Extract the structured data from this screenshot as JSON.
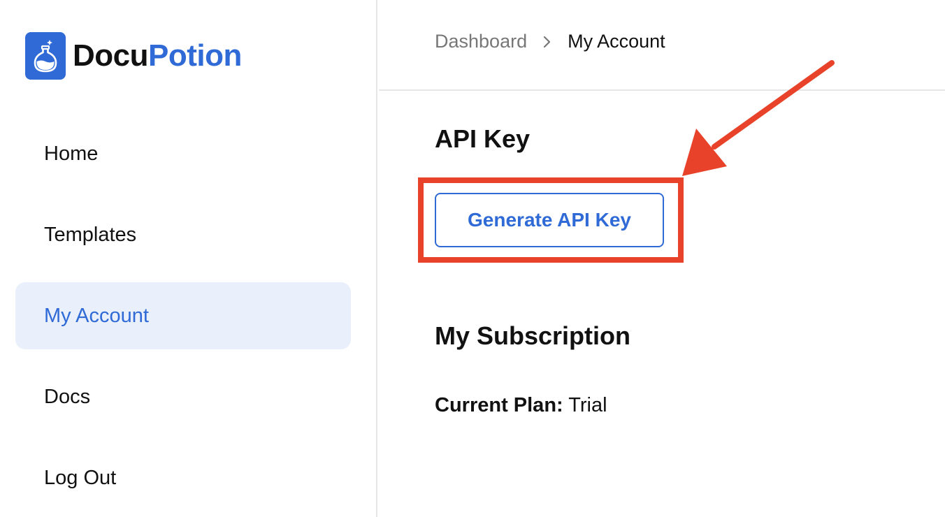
{
  "brand": {
    "name_part1": "Docu",
    "name_part2": "Potion",
    "primary_color": "#2f6ad6",
    "icon": "potion-flask-icon"
  },
  "sidebar": {
    "items": [
      {
        "label": "Home",
        "active": false
      },
      {
        "label": "Templates",
        "active": false
      },
      {
        "label": "My Account",
        "active": true
      },
      {
        "label": "Docs",
        "active": false
      },
      {
        "label": "Log Out",
        "active": false
      }
    ]
  },
  "breadcrumb": {
    "parent": "Dashboard",
    "separator_icon": "chevron-right-icon",
    "current": "My Account"
  },
  "api_section": {
    "title": "API Key",
    "button_label": "Generate API Key"
  },
  "subscription": {
    "title": "My Subscription",
    "plan_label": "Current Plan:",
    "plan_value": "Trial"
  },
  "annotation": {
    "color": "#e8432a"
  }
}
